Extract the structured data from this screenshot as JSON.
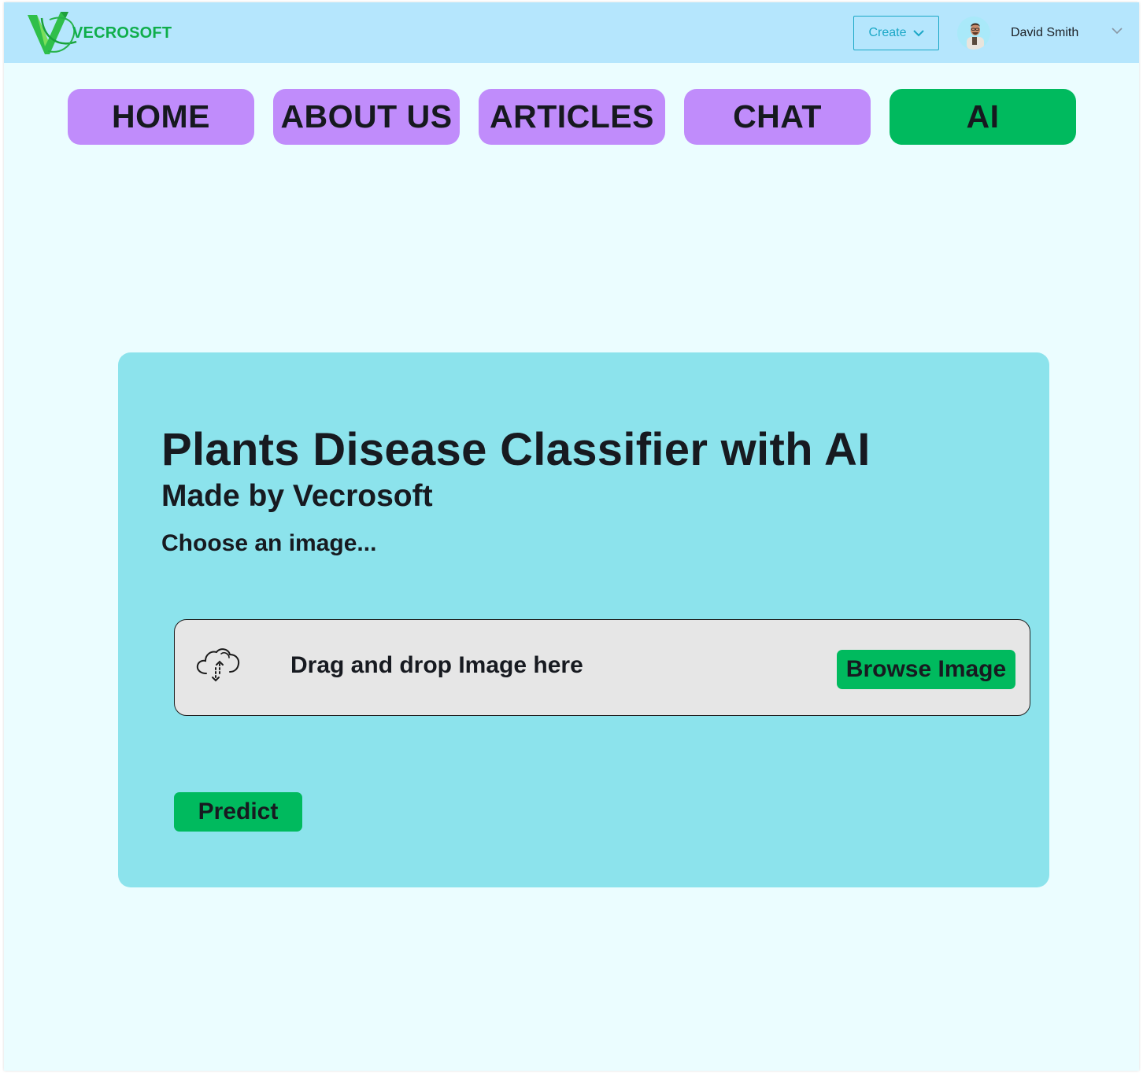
{
  "header": {
    "brand": "VECROSOFT",
    "create_label": "Create",
    "user_name": "David Smith"
  },
  "nav": {
    "items": [
      {
        "label": "HOME",
        "active": false
      },
      {
        "label": "ABOUT US",
        "active": false
      },
      {
        "label": "ARTICLES",
        "active": false
      },
      {
        "label": "CHAT",
        "active": false
      },
      {
        "label": "AI",
        "active": true
      }
    ]
  },
  "main": {
    "title": "Plants Disease Classifier with AI",
    "subtitle": "Made by Vecrosoft",
    "choose_label": "Choose an image...",
    "dropzone_text": "Drag and drop Image here",
    "browse_label": "Browse Image",
    "predict_label": "Predict"
  },
  "colors": {
    "header_bg": "#b5e6fd",
    "page_bg": "#ebfdff",
    "nav_bg": "#c08cfb",
    "accent_green": "#00ba5e",
    "card_bg": "#8ce3ec",
    "create_border": "#1aa7c6"
  },
  "icons": {
    "logo": "vecrosoft-check-logo",
    "create_chevron": "chevron-down-icon",
    "user_chevron": "chevron-down-icon",
    "upload": "cloud-upload-icon"
  }
}
